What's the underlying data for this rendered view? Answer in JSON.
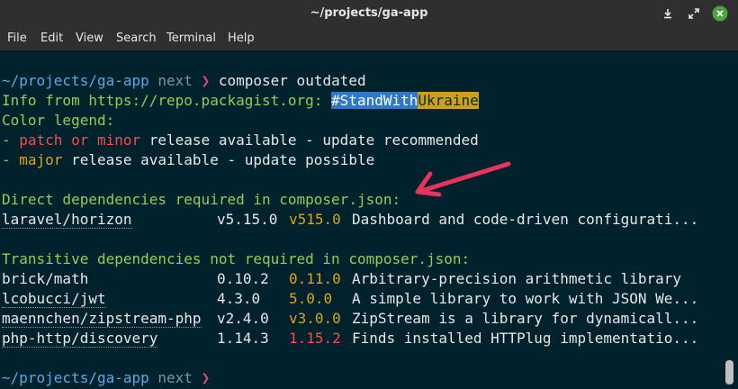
{
  "window": {
    "title": "~/projects/ga-app"
  },
  "menubar": {
    "items": [
      "File",
      "Edit",
      "View",
      "Search",
      "Terminal",
      "Help"
    ]
  },
  "prompt": {
    "path": "~/projects/ga-app",
    "branch": "next",
    "symbol": "❯",
    "command": "composer outdated"
  },
  "info": {
    "prefix": "Info from https://repo.packagist.org: ",
    "tag_part1": "#StandWith",
    "tag_part2": "Ukraine"
  },
  "legend": {
    "title": "Color legend:",
    "dash": "- ",
    "patch": "patch or minor",
    "patch_rest": " release available - update recommended",
    "major": "major",
    "major_rest": " release available - update possible"
  },
  "direct": {
    "heading": "Direct dependencies required in composer.json:",
    "rows": [
      {
        "name": "laravel/horizon",
        "current": "v5.15.0",
        "latest": "v515.0",
        "desc": "Dashboard and code-driven configurati..."
      }
    ]
  },
  "transitive": {
    "heading": "Transitive dependencies not required in composer.json:",
    "rows": [
      {
        "name": "brick/math",
        "current": "0.10.2",
        "latest": "0.11.0",
        "desc": "Arbitrary-precision arithmetic library"
      },
      {
        "name": "lcobucci/jwt",
        "current": "4.3.0",
        "latest": "5.0.0",
        "desc": "A simple library to work with JSON We..."
      },
      {
        "name": "maennchen/zipstream-php",
        "current": "v2.4.0",
        "latest": "v3.0.0",
        "desc": "ZipStream is a library for dynamicall..."
      },
      {
        "name": "php-http/discovery",
        "current": "1.14.3",
        "latest": "1.15.2",
        "desc": "Finds installed HTTPlug implementatio..."
      }
    ]
  },
  "colors": {
    "background": "#00222c",
    "prompt_path": "#5aa8e6",
    "prompt_symbol": "#e6437a",
    "heading": "#8fcf55",
    "patch": "#ff4b45",
    "major": "#e0a415",
    "annotation_arrow": "#e8335e"
  },
  "icons": {
    "minimize": "download-arrow-icon",
    "maximize": "expand-icon",
    "close": "close-circle-icon"
  }
}
